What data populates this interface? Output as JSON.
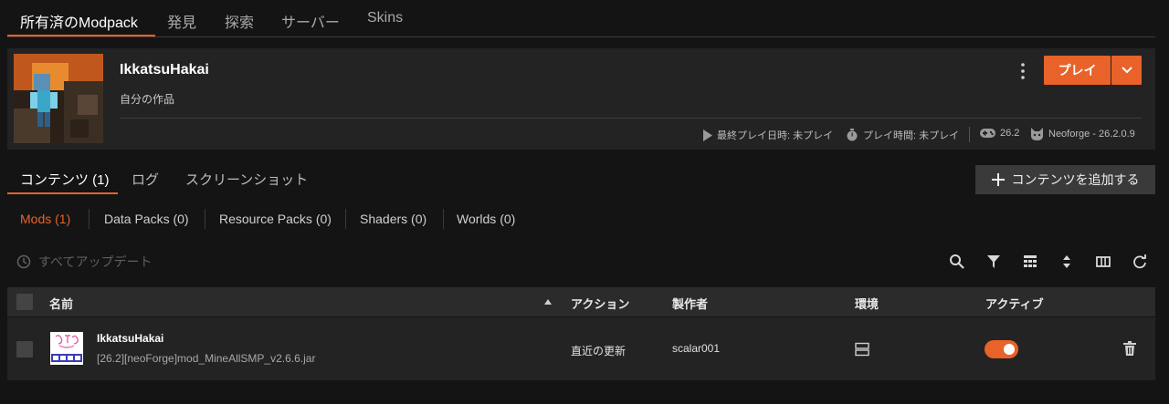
{
  "top_tabs": [
    "所有済のModpack",
    "発見",
    "探索",
    "サーバー",
    "Skins"
  ],
  "profile": {
    "name": "IkkatsuHakai",
    "subtitle": "自分の作品",
    "last_played_label": "最終プレイ日時: 未プレイ",
    "play_time_label": "プレイ時間: 未プレイ",
    "game_version": "26.2",
    "loader": "Neoforge - 26.2.0.9",
    "play_button": "プレイ"
  },
  "content_tabs": [
    "コンテンツ (1)",
    "ログ",
    "スクリーンショット"
  ],
  "add_content_button": "コンテンツを追加する",
  "filters": [
    "Mods (1)",
    "Data Packs (0)",
    "Resource Packs (0)",
    "Shaders (0)",
    "Worlds (0)"
  ],
  "update_all": "すべてアップデート",
  "table": {
    "headers": {
      "name": "名前",
      "action": "アクション",
      "author": "製作者",
      "env": "環境",
      "active": "アクティブ"
    },
    "rows": [
      {
        "name": "IkkatsuHakai",
        "file": "[26.2][neoForge]mod_MineAllSMP_v2.6.6.jar",
        "action": "直近の更新",
        "author": "scalar001",
        "active": true
      }
    ]
  },
  "colors": {
    "accent": "#e8622a",
    "background": "#141414",
    "card": "#232323"
  }
}
